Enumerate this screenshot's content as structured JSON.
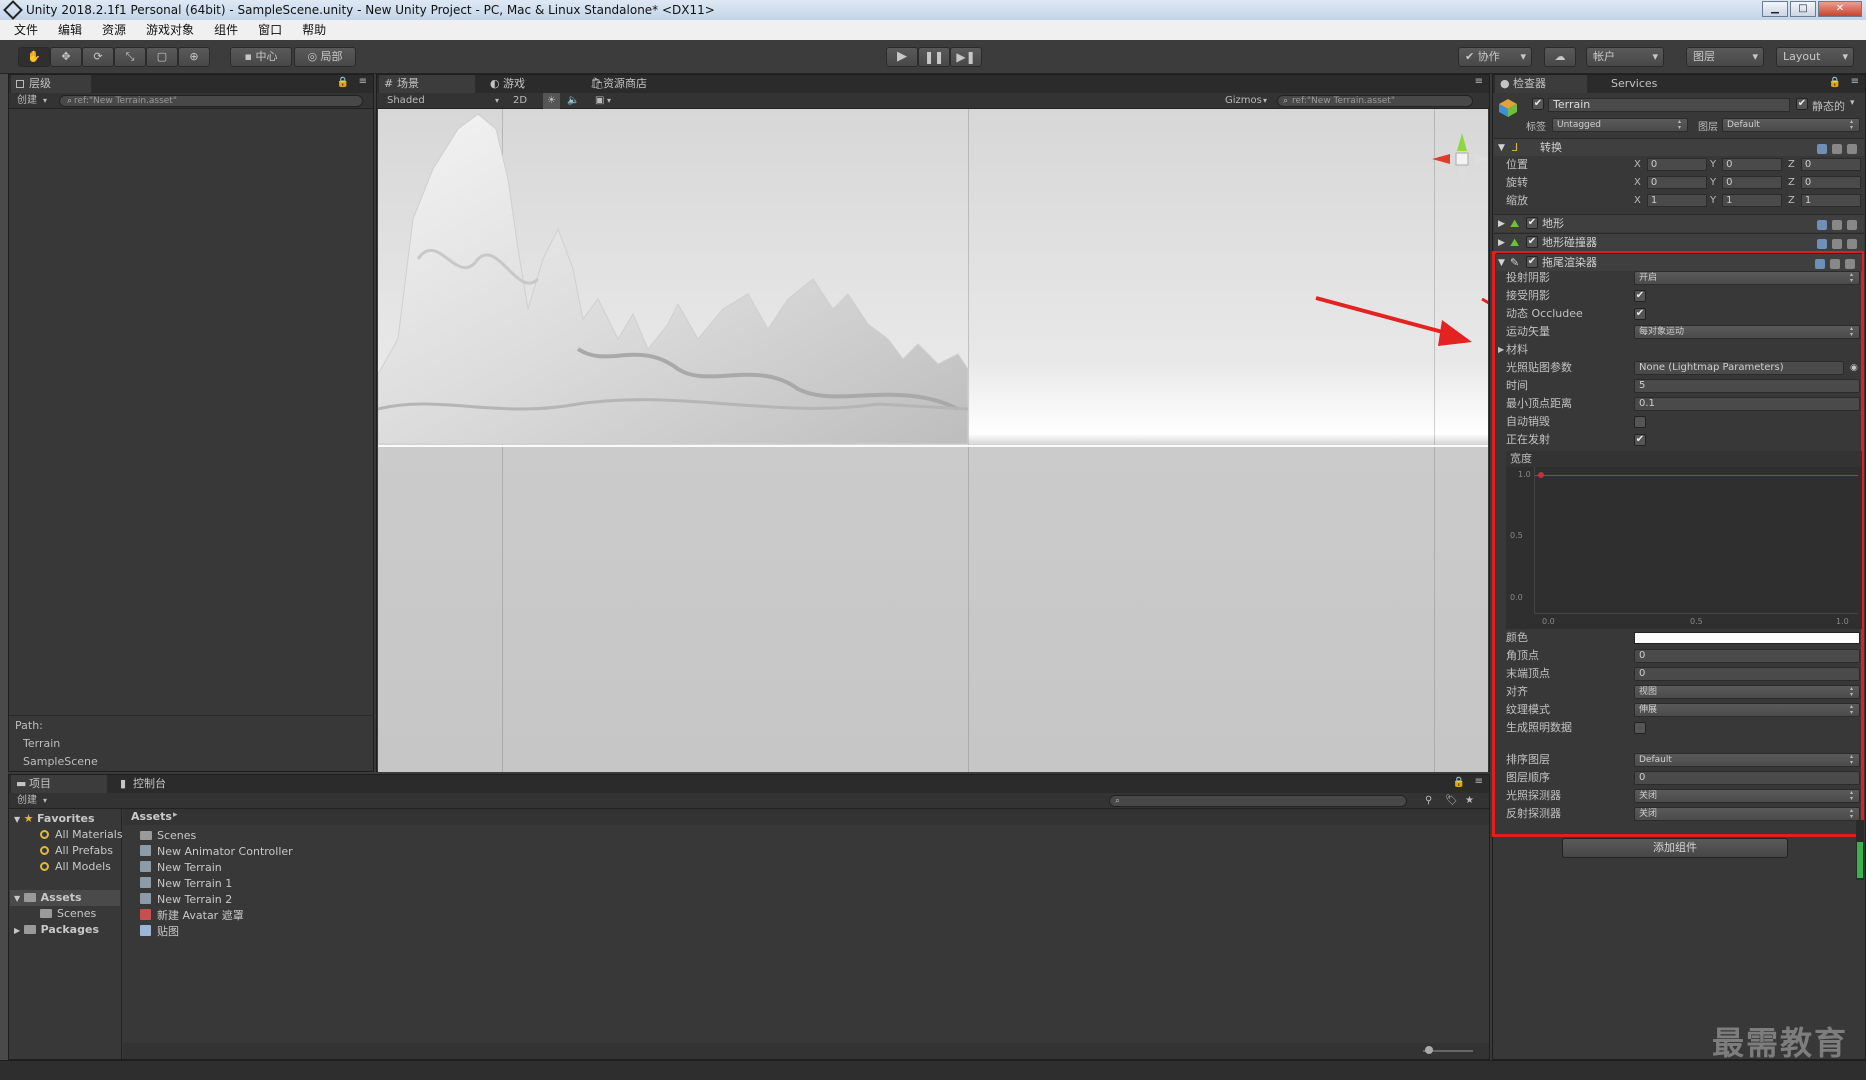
{
  "window": {
    "title": "Unity 2018.2.1f1 Personal (64bit) - SampleScene.unity - New Unity Project - PC, Mac & Linux Standalone* <DX11>",
    "minimize": "▁",
    "maximize": "□",
    "close": "✕"
  },
  "menu": [
    "文件",
    "编辑",
    "资源",
    "游戏对象",
    "组件",
    "窗口",
    "帮助"
  ],
  "toolbar": {
    "pivot_label": "中心",
    "local_label": "局部",
    "collab_label": "协作",
    "account_label": "帐户",
    "layers_label": "图层",
    "layout_label": "Layout"
  },
  "hierarchy": {
    "tab": "层级",
    "create": "创建",
    "search": "ref:\"New Terrain.asset\"",
    "path_label": "Path:",
    "path": [
      "Terrain",
      "SampleScene"
    ]
  },
  "scene": {
    "tabs": [
      "场景",
      "游戏",
      "资源商店"
    ],
    "shade_mode": "Shaded",
    "mode_2d": "2D",
    "gizmos": "Gizmos",
    "search": "ref:\"New Terrain.asset\""
  },
  "inspector": {
    "tabs": [
      "检查器",
      "Services"
    ],
    "object_name": "Terrain",
    "static_label": "静态的",
    "tag_label": "标签",
    "tag_value": "Untagged",
    "layer_label": "图层",
    "layer_value": "Default",
    "transform": {
      "header": "转换",
      "rows": [
        {
          "label": "位置",
          "x": "0",
          "y": "0",
          "z": "0"
        },
        {
          "label": "旋转",
          "x": "0",
          "y": "0",
          "z": "0"
        },
        {
          "label": "缩放",
          "x": "1",
          "y": "1",
          "z": "1"
        }
      ]
    },
    "axis_x": "X",
    "axis_y": "Y",
    "axis_z": "Z",
    "terrain_header": "地形",
    "collider_header": "地形碰撞器",
    "trail_header": "拖尾渲染器",
    "trail": {
      "cast_shadows": {
        "label": "投射阴影",
        "value": "开启"
      },
      "receive_shadows": {
        "label": "接受阴影"
      },
      "occludee": {
        "label": "动态 Occludee"
      },
      "motion_vectors": {
        "label": "运动矢量",
        "value": "每对象运动"
      },
      "materials": {
        "label": "材料"
      },
      "lightmap": {
        "label": "光照贴图参数",
        "value": "None (Lightmap Parameters)"
      },
      "time": {
        "label": "时间",
        "value": "5"
      },
      "min_vertex": {
        "label": "最小顶点距离",
        "value": "0.1"
      },
      "autodestruct": {
        "label": "自动销毁"
      },
      "emitting": {
        "label": "正在发射"
      },
      "width": {
        "label": "宽度"
      },
      "curve_y_ticks": [
        "1.0",
        "0.5",
        "0.0"
      ],
      "curve_x_ticks": [
        "0.0",
        "0.5",
        "1.0"
      ],
      "color": {
        "label": "颜色"
      },
      "corner_vertices": {
        "label": "角顶点",
        "value": "0"
      },
      "end_cap_vertices": {
        "label": "末端顶点",
        "value": "0"
      },
      "alignment": {
        "label": "对齐",
        "value": "视图"
      },
      "texture_mode": {
        "label": "纹理模式",
        "value": "伸展"
      },
      "generate_lighting": {
        "label": "生成照明数据"
      },
      "sorting_layer": {
        "label": "排序图层",
        "value": "Default"
      },
      "order_in_layer": {
        "label": "图层顺序",
        "value": "0"
      },
      "light_probes": {
        "label": "光照探测器",
        "value": "关闭"
      },
      "reflection_probes": {
        "label": "反射探测器",
        "value": "关闭"
      }
    },
    "add_component": "添加组件"
  },
  "project": {
    "tabs": [
      "项目",
      "控制台"
    ],
    "create": "创建",
    "favorites_label": "Favorites",
    "favorites": [
      "All Materials",
      "All Prefabs",
      "All Models"
    ],
    "assets_label": "Assets",
    "assets_children": [
      "Scenes"
    ],
    "packages_label": "Packages",
    "breadcrumb": "Assets",
    "items": [
      "Scenes",
      "New Animator Controller",
      "New Terrain",
      "New Terrain 1",
      "New Terrain 2",
      "新建 Avatar 遮罩",
      "贴图"
    ]
  },
  "watermark": "最需教育",
  "colors": {
    "highlight": "#e02020",
    "arrow": "#e52222"
  }
}
